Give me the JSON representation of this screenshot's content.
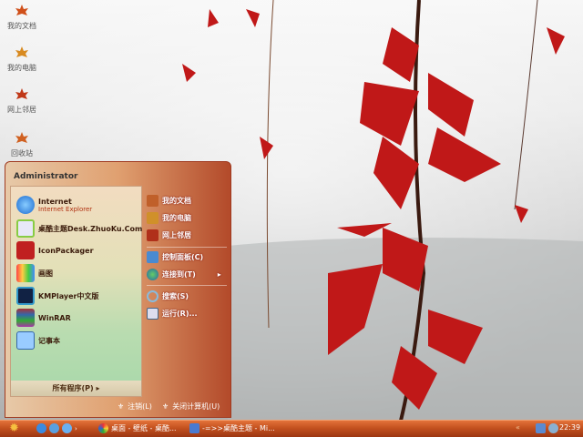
{
  "desktop": {
    "icons": [
      {
        "label": "我的文档",
        "icon": "maple-leaf-icon"
      },
      {
        "label": "我的电脑",
        "icon": "maple-leaf-icon"
      },
      {
        "label": "网上邻居",
        "icon": "maple-leaf-icon"
      },
      {
        "label": "回收站",
        "icon": "maple-leaf-icon"
      }
    ]
  },
  "start_menu": {
    "user": "Administrator",
    "programs": [
      {
        "label": "Internet",
        "sub": "Internet Explorer",
        "icon": "internet-explorer-icon"
      },
      {
        "label": "桌酷主题Desk.ZhuoKu.Com",
        "icon": "zhuoku-icon"
      },
      {
        "label": "IconPackager",
        "icon": "iconpackager-icon"
      },
      {
        "label": "画图",
        "icon": "paint-icon"
      },
      {
        "label": "KMPlayer中文版",
        "icon": "kmplayer-icon"
      },
      {
        "label": "WinRAR",
        "icon": "winrar-icon"
      },
      {
        "label": "记事本",
        "icon": "notepad-icon"
      }
    ],
    "all_programs": "所有程序(P)",
    "places": [
      {
        "label": "我的文档"
      },
      {
        "label": "我的电脑"
      },
      {
        "label": "网上邻居"
      },
      {
        "label": "控制面板(C)"
      },
      {
        "label": "连接到(T)"
      },
      {
        "label": "搜索(S)"
      },
      {
        "label": "运行(R)..."
      }
    ],
    "logoff": "注销(L)",
    "shutdown": "关闭计算机(U)"
  },
  "taskbar": {
    "tasks": [
      {
        "label": "桌面 - 壁纸 - 桌酷..."
      },
      {
        "label": "-=>>桌酷主题 - Mi..."
      }
    ],
    "clock": "22:39"
  },
  "colors": {
    "taskbar": "#c4511f",
    "accent": "#b03010"
  }
}
